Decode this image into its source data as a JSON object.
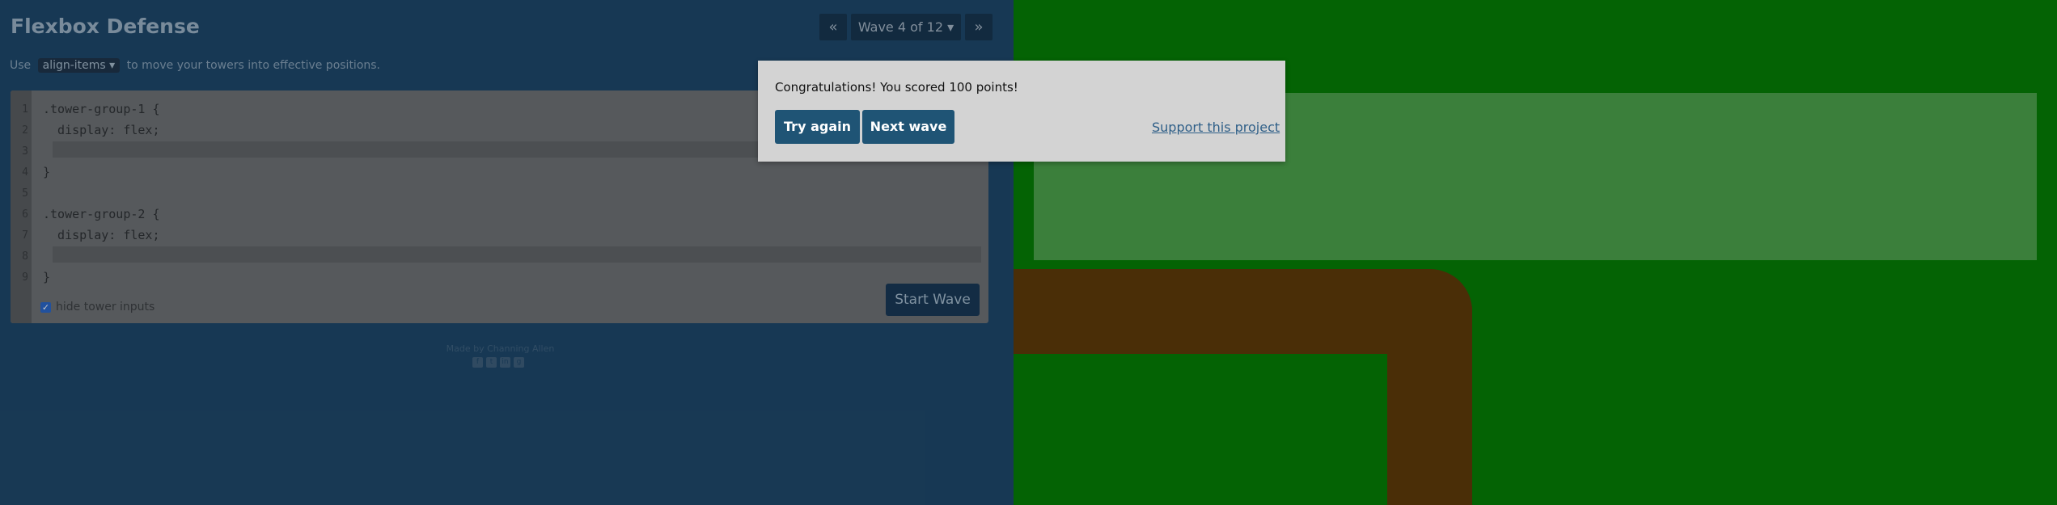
{
  "header": {
    "title": "Flexbox Defense",
    "prev_icon": "«",
    "wave_label": "Wave 4 of 12",
    "wave_caret": "▾",
    "next_icon": "»"
  },
  "instructions": {
    "before": "Use",
    "property": "align-items",
    "property_caret": "▾",
    "after": "to move your towers into effective positions."
  },
  "editor": {
    "line_numbers": [
      "1",
      "2",
      "3",
      "4",
      "5",
      "6",
      "7",
      "8",
      "9"
    ],
    "lines": [
      ".tower-group-1 {",
      "  display: flex;",
      "",
      "}",
      "",
      ".tower-group-2 {",
      "  display: flex;",
      "",
      "}"
    ],
    "hide_label": "hide tower inputs",
    "hide_checked": true,
    "start_label": "Start Wave"
  },
  "footer": {
    "credit": "Made by Channing Allen",
    "socials": [
      "facebook-icon",
      "twitter-icon",
      "linkedin-icon",
      "github-icon"
    ]
  },
  "modal": {
    "message": "Congratulations! You scored 100 points!",
    "try_again": "Try again",
    "next_wave": "Next wave",
    "support": "Support this project"
  },
  "colors": {
    "grass": "#046304",
    "path": "#4a2e07",
    "tower_zone": "#3b7f3b",
    "panel": "#1d4566",
    "button": "#1f5475"
  }
}
